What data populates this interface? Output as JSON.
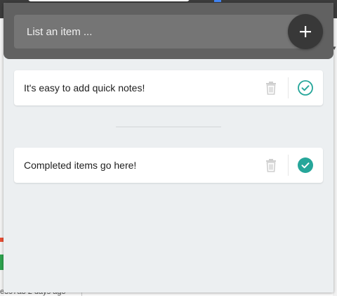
{
  "input": {
    "placeholder": "List an item ..."
  },
  "notes": {
    "active": [
      {
        "text": "It's easy to add quick notes!",
        "completed": false
      }
    ],
    "completed": [
      {
        "text": "Completed items go here!",
        "completed": true
      }
    ]
  },
  "background": {
    "bottom_text": "e897a3 2 days ago"
  },
  "colors": {
    "header": "#616161",
    "input": "#757575",
    "add_button": "#383838",
    "panel": "#eceff1",
    "accent": "#26a69a",
    "trash": "#cfcfcf"
  },
  "icons": {
    "add": "plus-icon",
    "delete": "trash-icon",
    "check_outline": "check-circle-outline-icon",
    "check_filled": "check-circle-filled-icon"
  }
}
